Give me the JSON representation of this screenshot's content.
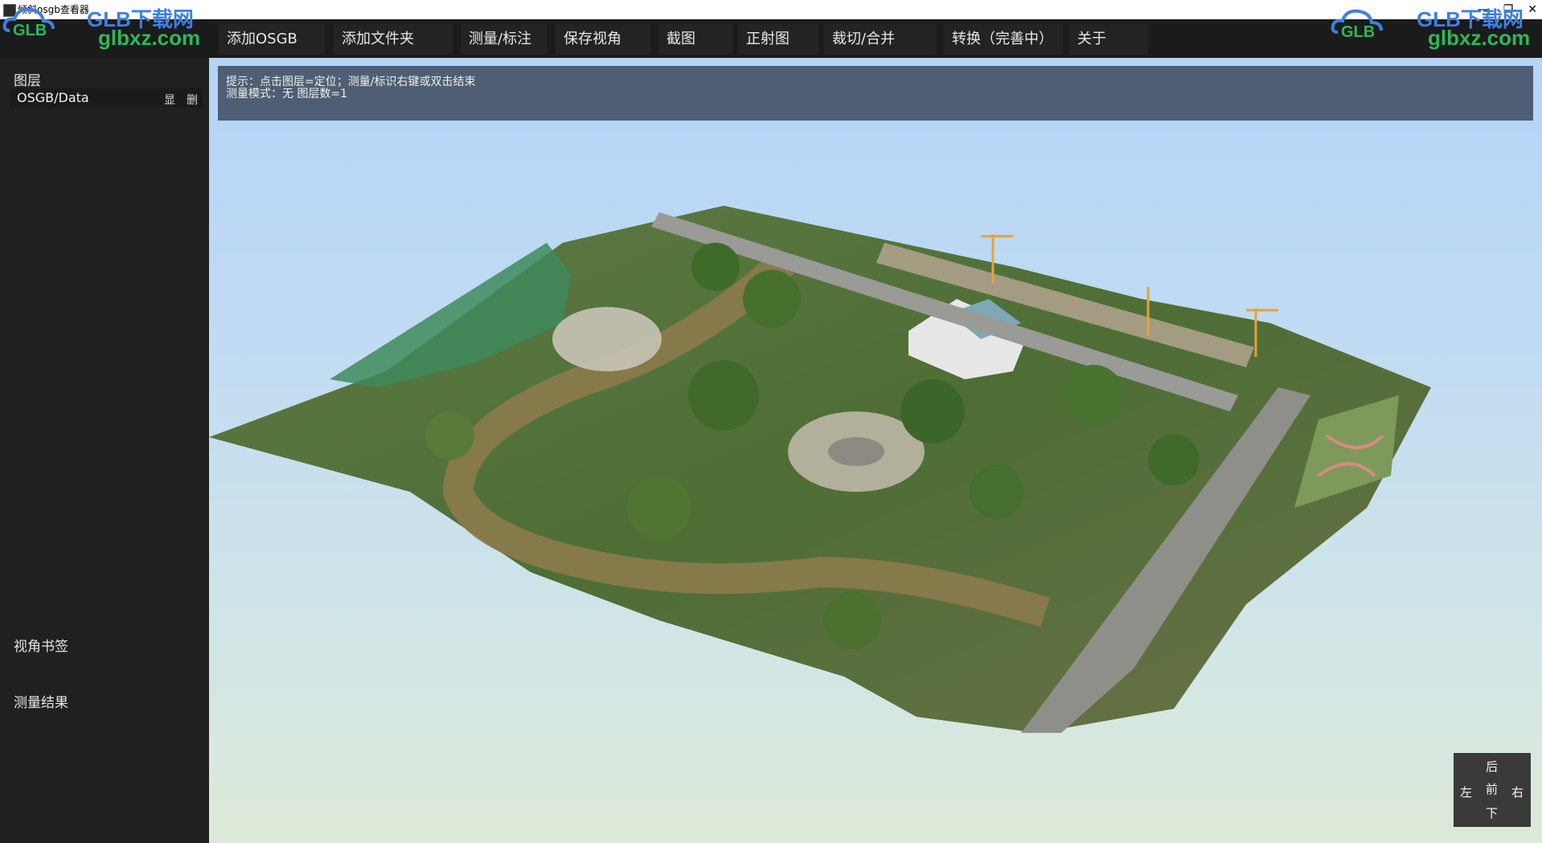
{
  "window": {
    "title": "倾斜osgb查看器",
    "minimize": "—",
    "restore": "❐",
    "close": "✕"
  },
  "toolbar": {
    "buttons": [
      "添加OSGB",
      "添加文件夹",
      "测量/标注",
      "保存视角",
      "截图",
      "正射图",
      "裁切/合并",
      "转换（完善中）",
      "关于"
    ]
  },
  "watermark": {
    "cn": "GLB下载网",
    "url": "glbxz.com",
    "logo": "GLB",
    "cloud_color": "#3f7fe0",
    "url_color": "#2db85a"
  },
  "sidebar": {
    "layers_heading": "图层",
    "layers": [
      {
        "name": "OSGB/Data",
        "show": "显",
        "delete": "删"
      }
    ],
    "bookmarks_heading": "视角书签",
    "results_heading": "测量结果"
  },
  "viewport": {
    "hint_line1": "提示：点击图层=定位；测量/标识右键或双击结束",
    "hint_line2": "测量模式：无   图层数=1"
  },
  "navpad": {
    "back": "后",
    "left": "左",
    "front": "前",
    "right": "右",
    "down": "下"
  },
  "colors": {
    "toolbar_bg": "#1b1b1b",
    "sidebar_bg": "#202020",
    "hint_bg": "#4f5e74",
    "sky_top": "#b4d4f8",
    "sky_bottom": "#dde9d8"
  }
}
